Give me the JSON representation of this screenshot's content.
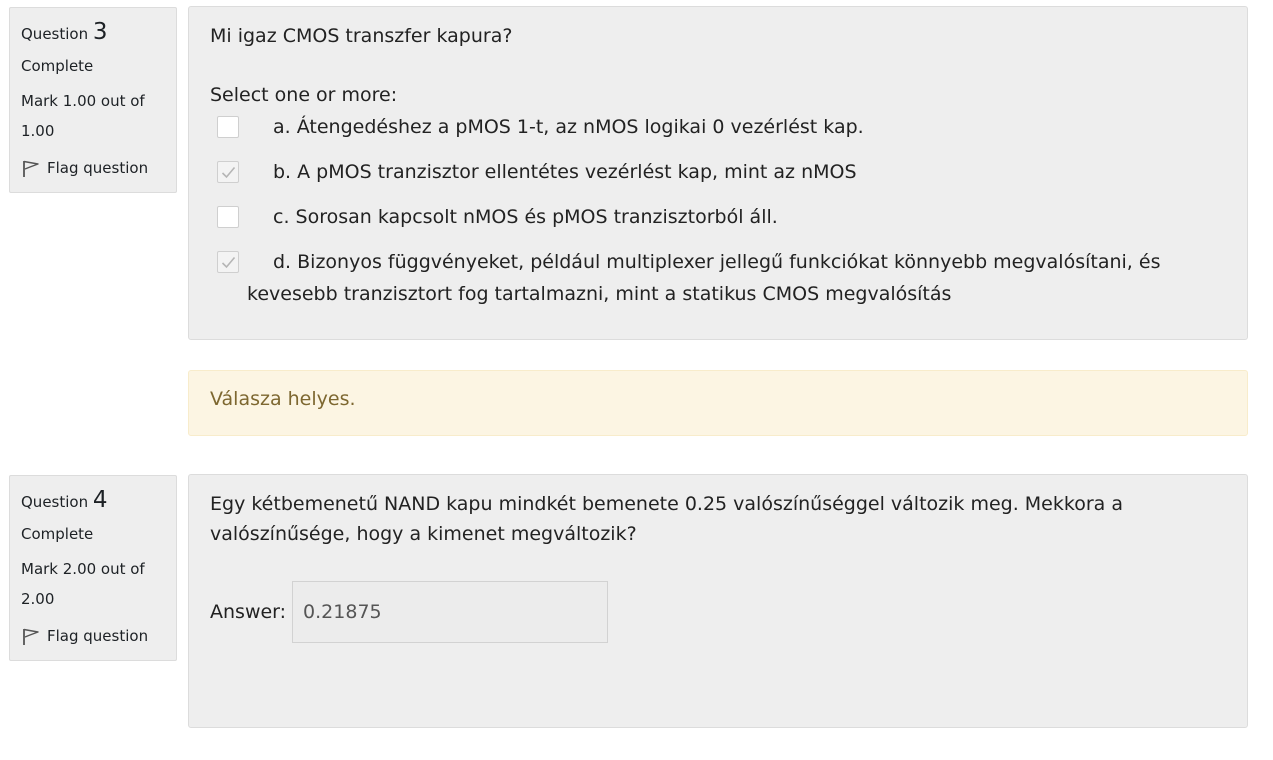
{
  "q3": {
    "info": {
      "question_word": "Question",
      "number": "3",
      "state": "Complete",
      "mark": "Mark 1.00 out of 1.00",
      "flag": "Flag question"
    },
    "text": "Mi igaz CMOS transzfer kapura?",
    "prompt": "Select one or more:",
    "options": [
      {
        "label": "a. Átengedéshez a pMOS 1-t, az nMOS logikai 0 vezérlést kap.",
        "checked": false
      },
      {
        "label": "b. A pMOS tranzisztor ellentétes vezérlést kap, mint az nMOS",
        "checked": true
      },
      {
        "label": "c. Sorosan kapcsolt nMOS és pMOS tranzisztorból áll.",
        "checked": false
      },
      {
        "label": "d. Bizonyos függvényeket, például multiplexer jellegű funkciókat könnyebb megvalósítani, és kevesebb tranzisztort fog tartalmazni, mint a statikus CMOS megvalósítás",
        "checked": true
      }
    ],
    "feedback": "Válasza helyes."
  },
  "q4": {
    "info": {
      "question_word": "Question",
      "number": "4",
      "state": "Complete",
      "mark": "Mark 2.00 out of 2.00",
      "flag": "Flag question"
    },
    "text": "Egy kétbemenetű NAND kapu mindkét bemenete 0.25 valószínűséggel változik meg. Mekkora a valószínűsége, hogy a kimenet megváltozik?",
    "answer_label": "Answer:",
    "answer_value": "0.21875"
  },
  "colors": {
    "panel_bg": "#eeeeee",
    "feedback_bg": "#fcf5e3",
    "feedback_text": "#7d6730"
  },
  "icons": {
    "flag": "flag-icon",
    "check": "check-icon"
  }
}
